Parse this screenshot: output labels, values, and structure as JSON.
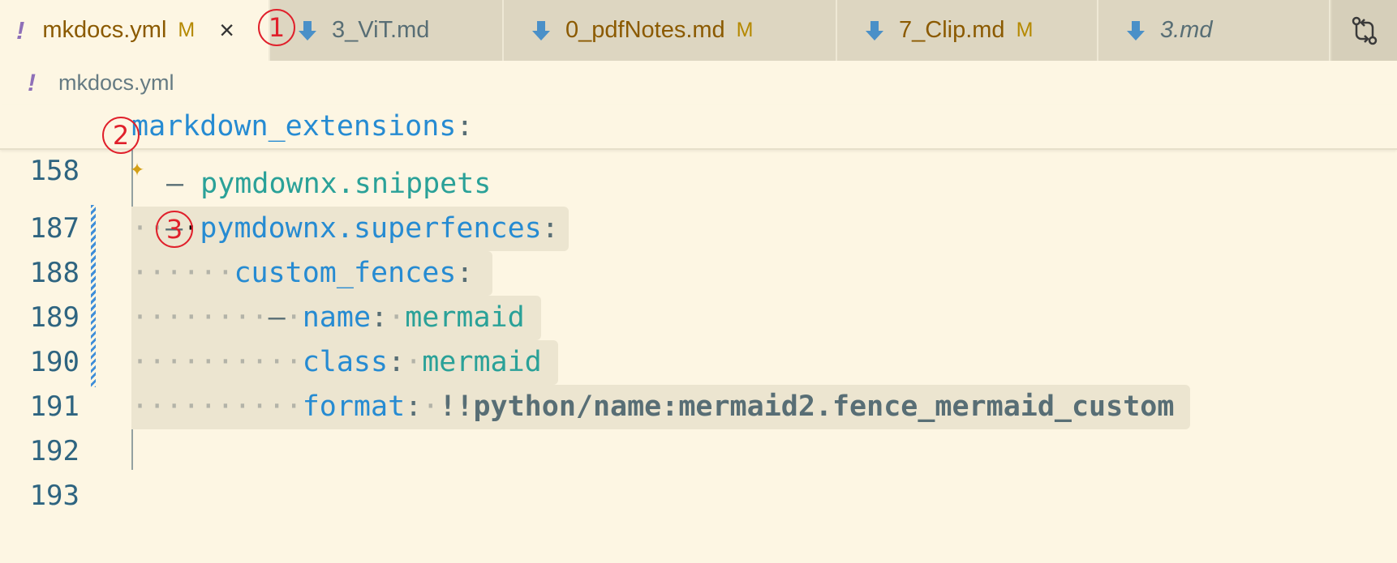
{
  "tabs": [
    {
      "name": "mkdocs.yml",
      "badge": "M"
    },
    {
      "name": "3_ViT.md",
      "badge": ""
    },
    {
      "name": "0_pdfNotes.md",
      "badge": "M"
    },
    {
      "name": "7_Clip.md",
      "badge": "M"
    },
    {
      "name": "3.md",
      "badge": ""
    }
  ],
  "tab_close": "×",
  "breadcrumb": {
    "icon_text": "!",
    "file": "mkdocs.yml"
  },
  "editor": {
    "sticky": {
      "ln": "158",
      "key": "markdown_extensions",
      "punc": ":"
    },
    "l187": {
      "ln": "187",
      "dash": "–",
      "value": "pymdownx.snippets"
    },
    "l188": {
      "ln": "188",
      "dots": "··",
      "dash": "–",
      "key": "pymdownx.superfences",
      "punc": ":"
    },
    "l189": {
      "ln": "189",
      "dots": "······",
      "key": "custom_fences",
      "punc": ":"
    },
    "l190": {
      "ln": "190",
      "dots": "········",
      "dash": "–",
      "dot2": "·",
      "key": "name",
      "punc": ":",
      "dot3": "·",
      "value": "mermaid"
    },
    "l191": {
      "ln": "191",
      "dots": "··········",
      "key": "class",
      "punc": ":",
      "dot2": "·",
      "value": "mermaid"
    },
    "l192": {
      "ln": "192",
      "dots": "··········",
      "key": "format",
      "punc": ":",
      "dot2": "·",
      "tag": "!!",
      "value": "python/name:mermaid2.fence_mermaid_custom"
    },
    "l193": {
      "ln": "193"
    }
  },
  "annotations": [
    "1",
    "2",
    "3"
  ],
  "colors": {
    "background": "#fdf6e3",
    "key": "#268bd2",
    "string": "#2aa198",
    "modified": "#b58900",
    "annotation": "#e0202b"
  }
}
